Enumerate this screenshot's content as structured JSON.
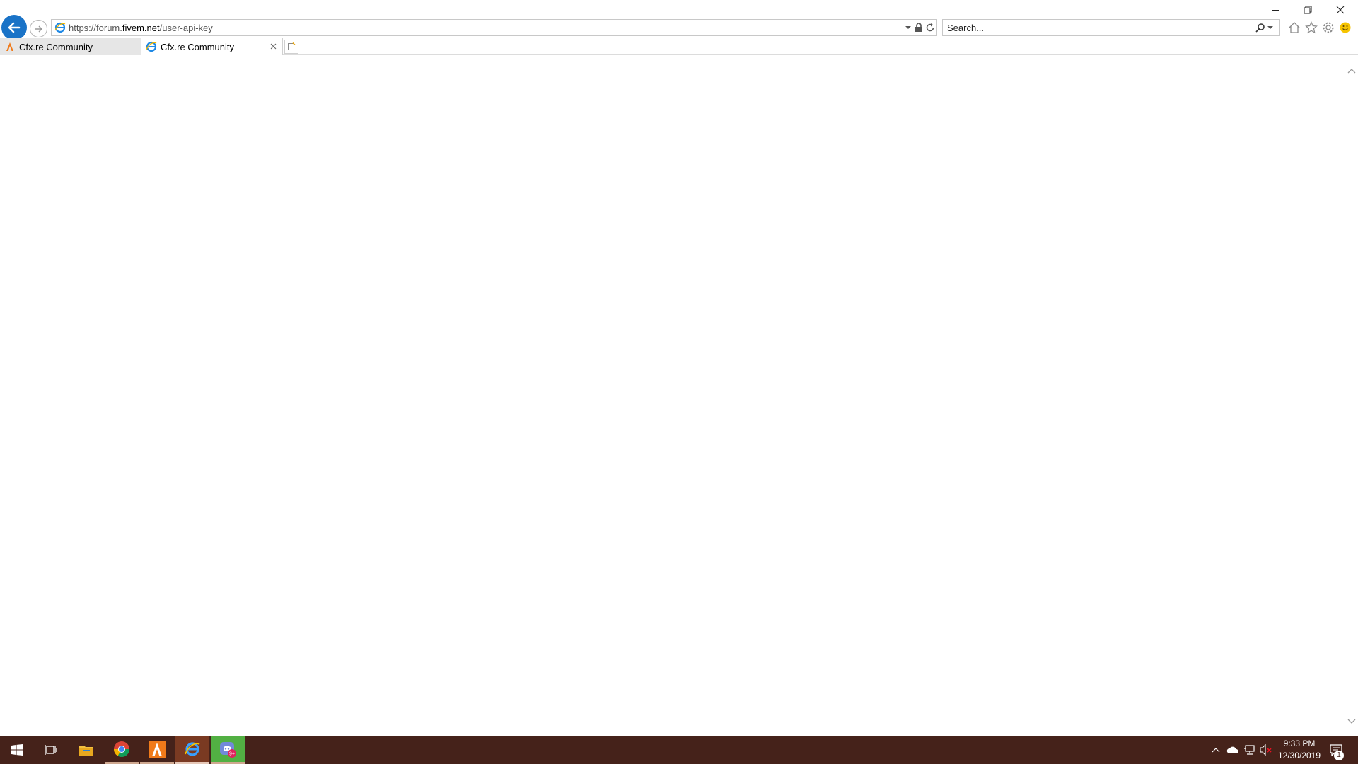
{
  "browser": {
    "address": {
      "url_prefix": "https://forum.",
      "url_domain": "fivem.net",
      "url_path": "/user-api-key"
    },
    "search": {
      "placeholder": "Search..."
    },
    "tabs": [
      {
        "label": "Cfx.re Community",
        "icon": "cfx-icon",
        "active": false
      },
      {
        "label": "Cfx.re Community",
        "icon": "ie-icon",
        "active": true
      }
    ],
    "accent": "#1a73c7"
  },
  "taskbar": {
    "background": "#45221a",
    "apps": [
      {
        "name": "start",
        "icon": "windows-icon"
      },
      {
        "name": "task-view",
        "icon": "task-view-icon"
      },
      {
        "name": "file-explorer",
        "icon": "folder-icon"
      },
      {
        "name": "chrome",
        "icon": "chrome-icon"
      },
      {
        "name": "cfx",
        "icon": "cfx-icon"
      },
      {
        "name": "internet-explorer",
        "icon": "ie-icon"
      },
      {
        "name": "discord",
        "icon": "discord-icon",
        "badge": "9+"
      }
    ],
    "clock": {
      "time": "9:33 PM",
      "date": "12/30/2019"
    },
    "notifications": "1"
  }
}
